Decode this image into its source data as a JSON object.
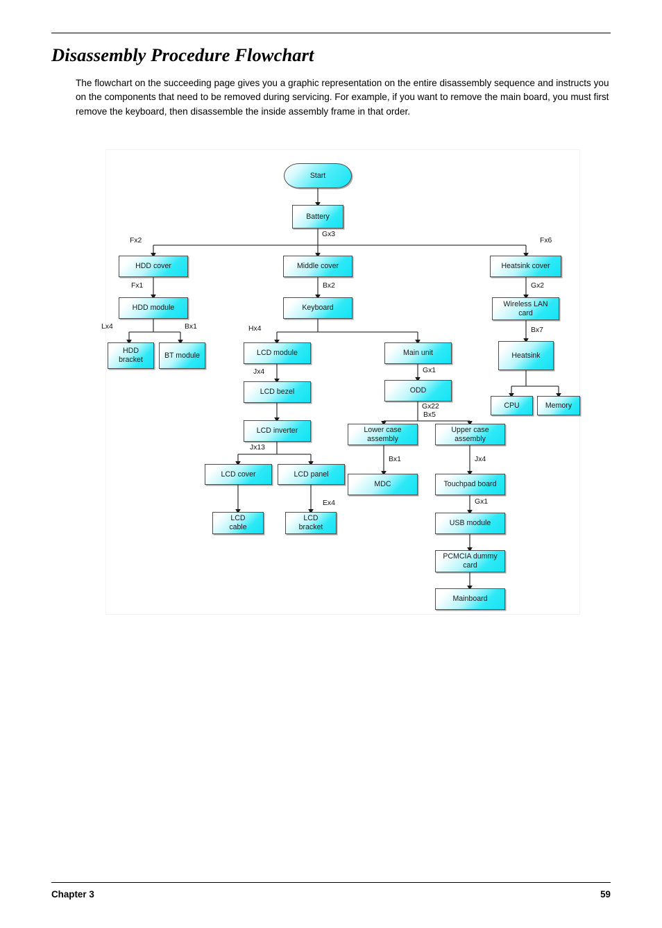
{
  "document": {
    "title": "Disassembly Procedure Flowchart",
    "intro": "The flowchart on the succeeding page gives you a graphic representation on the entire disassembly sequence and instructs you on the components that need to be removed during servicing. For example, if you want to remove the main board, you must first remove the keyboard, then disassemble the inside assembly frame in that order.",
    "footer": {
      "chapter": "Chapter 3",
      "page_number": "59"
    }
  },
  "colors": {
    "node_fill_start": "#ffffff",
    "node_fill_end": "#14e3f5",
    "node_border": "#4d4d4d",
    "connector": "#1a1a1a",
    "text": "#000000"
  },
  "flowchart": {
    "type": "diagram",
    "orientation": "top-down",
    "nodes": [
      {
        "id": "start",
        "label": "Start",
        "shape": "terminator"
      },
      {
        "id": "battery",
        "label": "Battery",
        "shape": "rect"
      },
      {
        "id": "hdd_cover",
        "label": "HDD cover",
        "shape": "rect"
      },
      {
        "id": "middle_cover",
        "label": "Middle cover",
        "shape": "rect"
      },
      {
        "id": "heatsink_cover",
        "label": "Heatsink cover",
        "shape": "rect"
      },
      {
        "id": "hdd_module",
        "label": "HDD module",
        "shape": "rect"
      },
      {
        "id": "keyboard",
        "label": "Keyboard",
        "shape": "rect"
      },
      {
        "id": "wlan_card",
        "label": "Wireless LAN card",
        "shape": "rect",
        "lines": [
          "Wireless LAN",
          "card"
        ]
      },
      {
        "id": "hdd_bracket",
        "label": "HDD bracket",
        "shape": "rect",
        "lines": [
          "HDD",
          "bracket"
        ]
      },
      {
        "id": "bt_module",
        "label": "BT module",
        "shape": "rect"
      },
      {
        "id": "lcd_module",
        "label": "LCD module",
        "shape": "rect"
      },
      {
        "id": "main_unit",
        "label": "Main unit",
        "shape": "rect"
      },
      {
        "id": "heatsink",
        "label": "Heatsink",
        "shape": "rect"
      },
      {
        "id": "lcd_bezel",
        "label": "LCD bezel",
        "shape": "rect"
      },
      {
        "id": "odd",
        "label": "ODD",
        "shape": "rect"
      },
      {
        "id": "cpu",
        "label": "CPU",
        "shape": "rect"
      },
      {
        "id": "memory",
        "label": "Memory",
        "shape": "rect"
      },
      {
        "id": "lcd_inverter",
        "label": "LCD inverter",
        "shape": "rect"
      },
      {
        "id": "lower_case",
        "label": "Lower case assembly",
        "shape": "rect",
        "lines": [
          "Lower case",
          "assembly"
        ]
      },
      {
        "id": "upper_case",
        "label": "Upper case assembly",
        "shape": "rect",
        "lines": [
          "Upper case",
          "assembly"
        ]
      },
      {
        "id": "lcd_cover",
        "label": "LCD cover",
        "shape": "rect"
      },
      {
        "id": "lcd_panel",
        "label": "LCD panel",
        "shape": "rect"
      },
      {
        "id": "mdc",
        "label": "MDC",
        "shape": "rect"
      },
      {
        "id": "touchpad",
        "label": "Touchpad board",
        "shape": "rect"
      },
      {
        "id": "lcd_cable",
        "label": "LCD cable",
        "shape": "rect",
        "lines": [
          "LCD",
          "cable"
        ]
      },
      {
        "id": "lcd_bracket",
        "label": "LCD bracket",
        "shape": "rect",
        "lines": [
          "LCD",
          "bracket"
        ]
      },
      {
        "id": "usb_module",
        "label": "USB module",
        "shape": "rect"
      },
      {
        "id": "pcmcia",
        "label": "PCMCIA dummy card",
        "shape": "rect",
        "lines": [
          "PCMCIA dummy",
          "card"
        ]
      },
      {
        "id": "mainboard",
        "label": "Mainboard",
        "shape": "rect"
      }
    ],
    "edges": [
      {
        "from": "start",
        "to": "battery",
        "label": ""
      },
      {
        "from": "battery",
        "to": "hdd_cover",
        "label": "Fx2"
      },
      {
        "from": "battery",
        "to": "middle_cover",
        "label": "Gx3"
      },
      {
        "from": "battery",
        "to": "heatsink_cover",
        "label": "Fx6"
      },
      {
        "from": "hdd_cover",
        "to": "hdd_module",
        "label": "Fx1"
      },
      {
        "from": "middle_cover",
        "to": "keyboard",
        "label": "Bx2"
      },
      {
        "from": "heatsink_cover",
        "to": "wlan_card",
        "label": "Gx2"
      },
      {
        "from": "hdd_module",
        "to": "hdd_bracket",
        "label": "Lx4"
      },
      {
        "from": "hdd_module",
        "to": "bt_module",
        "label": "Bx1"
      },
      {
        "from": "keyboard",
        "to": "lcd_module",
        "label": "Hx4"
      },
      {
        "from": "keyboard",
        "to": "main_unit",
        "label": ""
      },
      {
        "from": "wlan_card",
        "to": "heatsink",
        "label": "Bx7"
      },
      {
        "from": "lcd_module",
        "to": "lcd_bezel",
        "label": "Jx4"
      },
      {
        "from": "main_unit",
        "to": "odd",
        "label": "Gx1"
      },
      {
        "from": "heatsink",
        "to": "cpu",
        "label": ""
      },
      {
        "from": "heatsink",
        "to": "memory",
        "label": ""
      },
      {
        "from": "lcd_bezel",
        "to": "lcd_inverter",
        "label": ""
      },
      {
        "from": "odd",
        "to": "lower_case",
        "label": "Gx22 Bx5"
      },
      {
        "from": "odd",
        "to": "upper_case",
        "label": ""
      },
      {
        "from": "lcd_inverter",
        "to": "lcd_cover",
        "label": "Jx13"
      },
      {
        "from": "lcd_inverter",
        "to": "lcd_panel",
        "label": ""
      },
      {
        "from": "lower_case",
        "to": "mdc",
        "label": "Bx1"
      },
      {
        "from": "upper_case",
        "to": "touchpad",
        "label": "Jx4"
      },
      {
        "from": "lcd_cover",
        "to": "lcd_cable",
        "label": ""
      },
      {
        "from": "lcd_panel",
        "to": "lcd_bracket",
        "label": "Ex4"
      },
      {
        "from": "touchpad",
        "to": "usb_module",
        "label": "Gx1"
      },
      {
        "from": "usb_module",
        "to": "pcmcia",
        "label": ""
      },
      {
        "from": "pcmcia",
        "to": "mainboard",
        "label": ""
      }
    ],
    "edge_labels": [
      {
        "id": "fx2",
        "text": "Fx2"
      },
      {
        "id": "gx3",
        "text": "Gx3"
      },
      {
        "id": "fx6",
        "text": "Fx6"
      },
      {
        "id": "fx1",
        "text": "Fx1"
      },
      {
        "id": "bx2",
        "text": "Bx2"
      },
      {
        "id": "gx2",
        "text": "Gx2"
      },
      {
        "id": "lx4",
        "text": "Lx4"
      },
      {
        "id": "bx1a",
        "text": "Bx1"
      },
      {
        "id": "hx4",
        "text": "Hx4"
      },
      {
        "id": "bx7",
        "text": "Bx7"
      },
      {
        "id": "jx4a",
        "text": "Jx4"
      },
      {
        "id": "gx1a",
        "text": "Gx1"
      },
      {
        "id": "gx22",
        "text": "Gx22"
      },
      {
        "id": "bx5",
        "text": "Bx5"
      },
      {
        "id": "jx13",
        "text": "Jx13"
      },
      {
        "id": "bx1b",
        "text": "Bx1"
      },
      {
        "id": "jx4b",
        "text": "Jx4"
      },
      {
        "id": "ex4",
        "text": "Ex4"
      },
      {
        "id": "gx1b",
        "text": "Gx1"
      }
    ]
  }
}
